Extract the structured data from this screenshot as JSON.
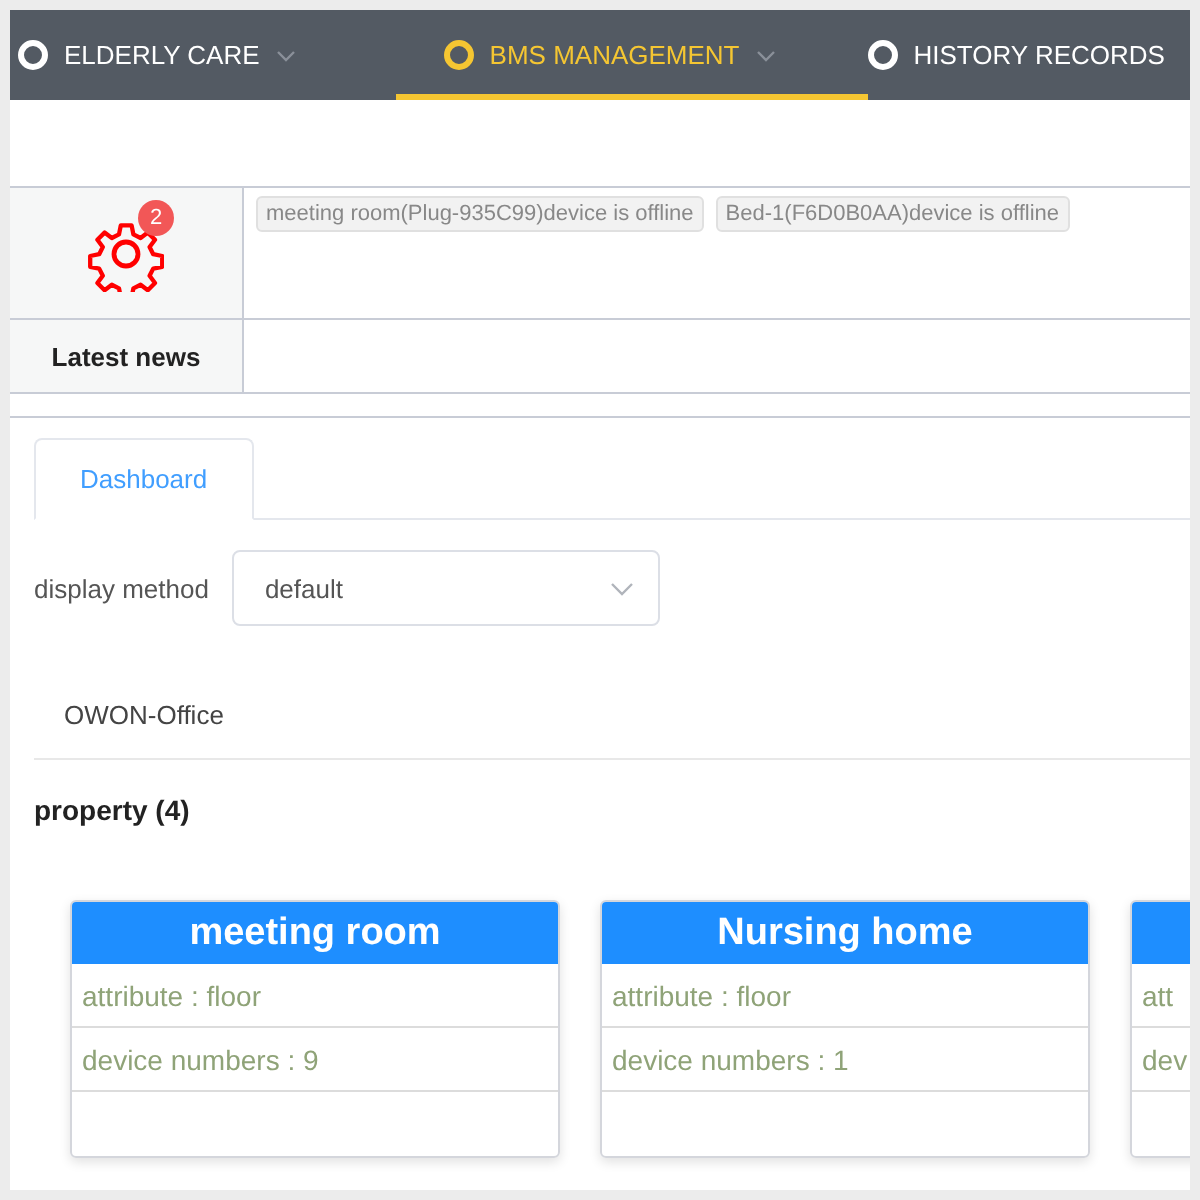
{
  "nav": [
    {
      "label": "ELDERLY CARE",
      "selected": false,
      "has_menu": true
    },
    {
      "label": "BMS MANAGEMENT",
      "selected": true,
      "has_menu": true
    },
    {
      "label": "HISTORY RECORDS",
      "selected": false,
      "has_menu": false
    }
  ],
  "alarms": {
    "count": "2",
    "messages": [
      "meeting room(Plug-935C99)device is offline",
      "Bed-1(F6D0B0AA)device is offline"
    ]
  },
  "news": {
    "label": "Latest news"
  },
  "tabs": [
    {
      "label": "Dashboard",
      "selected": true
    }
  ],
  "display_method": {
    "label": "display method",
    "value": "default"
  },
  "site": "OWON-Office",
  "section_title": "property (4)",
  "cards": [
    {
      "title": "meeting room",
      "rows": [
        "attribute : floor",
        "device numbers : 9"
      ]
    },
    {
      "title": "Nursing home",
      "rows": [
        "attribute : floor",
        "device numbers : 1"
      ]
    },
    {
      "rows": [
        "att",
        "dev"
      ]
    }
  ]
}
